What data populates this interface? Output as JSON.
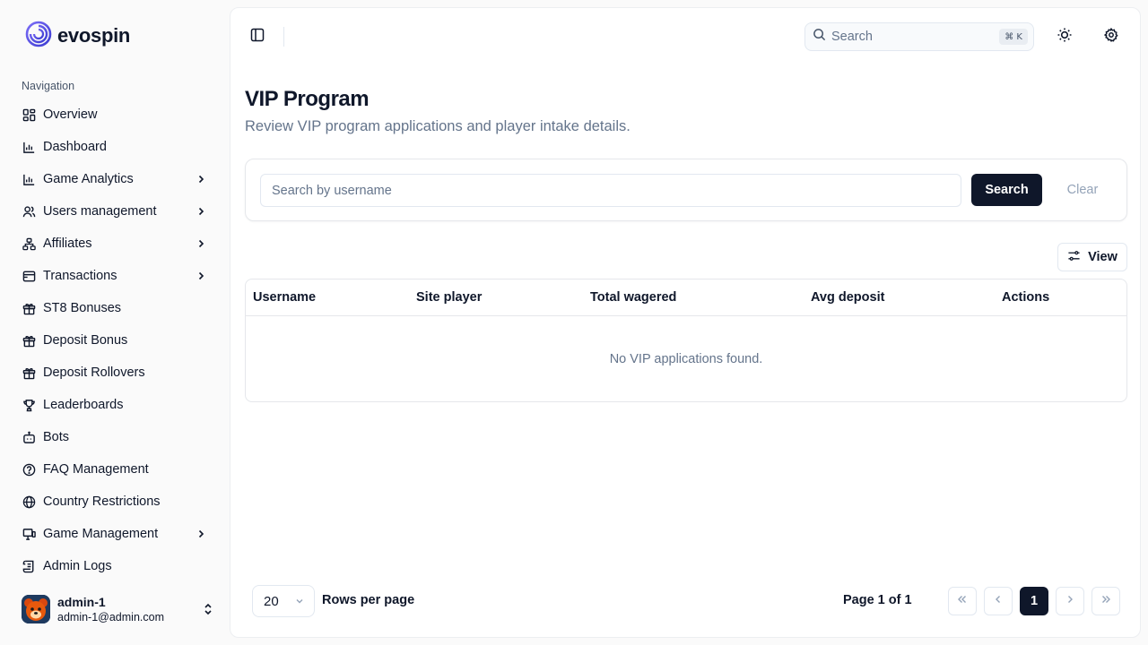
{
  "brand": {
    "name": "evospin",
    "accent": "#5b5bd6"
  },
  "sidebar": {
    "heading": "Navigation",
    "items": [
      {
        "label": "Overview",
        "icon": "grid-icon",
        "expandable": false
      },
      {
        "label": "Dashboard",
        "icon": "bar-chart-icon",
        "expandable": false
      },
      {
        "label": "Game Analytics",
        "icon": "bar-chart-icon",
        "expandable": true
      },
      {
        "label": "Users management",
        "icon": "users-icon",
        "expandable": true
      },
      {
        "label": "Affiliates",
        "icon": "network-icon",
        "expandable": true
      },
      {
        "label": "Transactions",
        "icon": "wallet-icon",
        "expandable": true
      },
      {
        "label": "ST8 Bonuses",
        "icon": "gift-icon",
        "expandable": false
      },
      {
        "label": "Deposit Bonus",
        "icon": "gift-icon",
        "expandable": false
      },
      {
        "label": "Deposit Rollovers",
        "icon": "gift-icon",
        "expandable": false
      },
      {
        "label": "Leaderboards",
        "icon": "trophy-icon",
        "expandable": false
      },
      {
        "label": "Bots",
        "icon": "bot-icon",
        "expandable": false
      },
      {
        "label": "FAQ Management",
        "icon": "help-circle-icon",
        "expandable": false
      },
      {
        "label": "Country Restrictions",
        "icon": "globe-icon",
        "expandable": false
      },
      {
        "label": "Game Management",
        "icon": "monitor-icon",
        "expandable": true
      },
      {
        "label": "Admin Logs",
        "icon": "scroll-icon",
        "expandable": false
      }
    ],
    "user": {
      "name": "admin-1",
      "email": "admin-1@admin.com"
    }
  },
  "header": {
    "search_placeholder": "Search",
    "search_shortcut": "⌘ K"
  },
  "page": {
    "title": "VIP Program",
    "subtitle": "Review VIP program applications and player intake details."
  },
  "filters": {
    "username_placeholder": "Search by username",
    "search_label": "Search",
    "clear_label": "Clear"
  },
  "table": {
    "view_label": "View",
    "columns": [
      "Username",
      "Site player",
      "Total wagered",
      "Avg deposit",
      "Actions"
    ],
    "rows": [],
    "empty_message": "No VIP applications found."
  },
  "pagination": {
    "rows_per_page_value": "20",
    "rows_per_page_label": "Rows per page",
    "page_info": "Page 1 of 1",
    "current_page": "1"
  }
}
